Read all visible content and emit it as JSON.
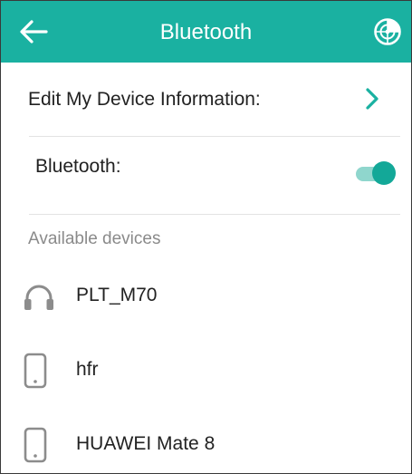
{
  "header": {
    "title": "Bluetooth",
    "back_icon": "arrow-left-icon",
    "scan_icon": "radar-scan-icon"
  },
  "settings": {
    "edit_device_label": "Edit My Device Information:",
    "bluetooth_label": "Bluetooth:",
    "bluetooth_enabled": true
  },
  "available": {
    "heading": "Available devices",
    "devices": [
      {
        "name": "PLT_M70",
        "icon": "headphones-icon"
      },
      {
        "name": "hfr",
        "icon": "mobile-phone-icon"
      },
      {
        "name": "HUAWEI Mate 8",
        "icon": "mobile-phone-icon"
      }
    ]
  },
  "colors": {
    "accent": "#1ab1a1",
    "toggle_thumb": "#13a898",
    "toggle_track": "#8fd6cd"
  }
}
